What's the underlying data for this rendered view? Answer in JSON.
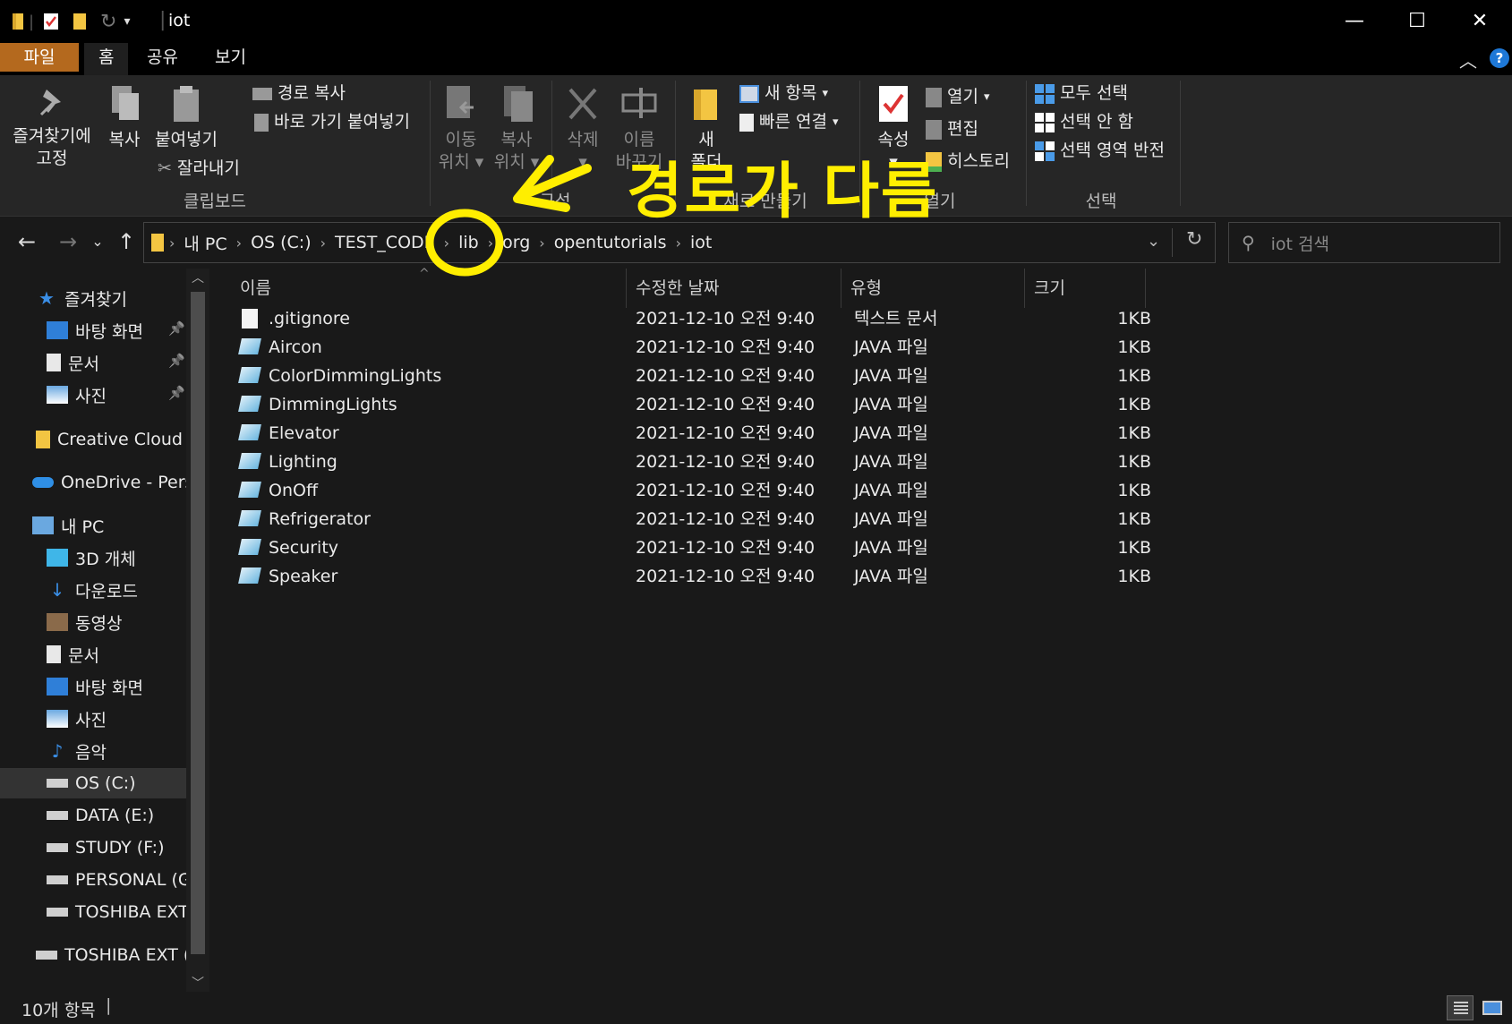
{
  "window": {
    "title": "iot",
    "minimize_glyph": "—",
    "maximize_glyph": "☐",
    "close_glyph": "✕"
  },
  "ribbon_tabs": [
    "파일",
    "홈",
    "공유",
    "보기"
  ],
  "ribbon": {
    "clipboard": {
      "pin_label_1": "즐겨찾기에",
      "pin_label_2": "고정",
      "copy": "복사",
      "paste": "붙여넣기",
      "copy_path": "경로 복사",
      "paste_shortcut": "바로 가기 붙여넣기",
      "cut": "잘라내기",
      "group": "클립보드"
    },
    "organize": {
      "move_to_1": "이동",
      "move_to_2": "위치",
      "copy_to_1": "복사",
      "copy_to_2": "위치",
      "delete": "삭제",
      "rename_1": "이름",
      "rename_2": "바꾸기",
      "group": "구성"
    },
    "new": {
      "new_folder_1": "새",
      "new_folder_2": "폴더",
      "new_item": "새 항목",
      "easy_access": "빠른 연결",
      "group": "새로 만들기"
    },
    "open": {
      "properties": "속성",
      "open": "열기",
      "edit": "편집",
      "history": "히스토리",
      "group": "열기"
    },
    "select": {
      "select_all": "모두 선택",
      "select_none": "선택 안 함",
      "invert": "선택 영역 반전",
      "group": "선택"
    }
  },
  "address": {
    "crumbs": [
      "내 PC",
      "OS (C:)",
      "TEST_CODE",
      "lib",
      "org",
      "opentutorials",
      "iot"
    ],
    "search_placeholder": "iot 검색"
  },
  "nav_pane": {
    "items": [
      {
        "label": "즐겨찾기",
        "icon": "star-icon",
        "pinned": false
      },
      {
        "label": "바탕 화면",
        "icon": "desktop-icon",
        "pinned": true
      },
      {
        "label": "문서",
        "icon": "document-icon",
        "pinned": true
      },
      {
        "label": "사진",
        "icon": "pictures-icon",
        "pinned": true
      },
      {
        "label": "Creative Cloud Files",
        "icon": "creative-cloud-icon",
        "pinned": false
      },
      {
        "label": "OneDrive - Personal",
        "icon": "onedrive-icon",
        "pinned": false
      },
      {
        "label": "내 PC",
        "icon": "pc-icon",
        "pinned": false
      },
      {
        "label": "3D 개체",
        "icon": "3d-objects-icon",
        "pinned": false
      },
      {
        "label": "다운로드",
        "icon": "download-icon",
        "pinned": false
      },
      {
        "label": "동영상",
        "icon": "video-icon",
        "pinned": false
      },
      {
        "label": "문서",
        "icon": "document-icon",
        "pinned": false
      },
      {
        "label": "바탕 화면",
        "icon": "desktop-icon",
        "pinned": false
      },
      {
        "label": "사진",
        "icon": "pictures-icon",
        "pinned": false
      },
      {
        "label": "음악",
        "icon": "music-icon",
        "pinned": false
      },
      {
        "label": "OS (C:)",
        "icon": "drive-icon",
        "pinned": false,
        "selected": true
      },
      {
        "label": "DATA (E:)",
        "icon": "drive-icon",
        "pinned": false
      },
      {
        "label": "STUDY (F:)",
        "icon": "drive-icon",
        "pinned": false
      },
      {
        "label": "PERSONAL (G:)",
        "icon": "drive-icon",
        "pinned": false
      },
      {
        "label": "TOSHIBA EXT (I:)",
        "icon": "drive-icon",
        "pinned": false
      },
      {
        "label": "TOSHIBA EXT (I:)",
        "icon": "drive-icon",
        "pinned": false
      }
    ]
  },
  "file_list": {
    "columns": [
      "이름",
      "수정한 날짜",
      "유형",
      "크기"
    ],
    "rows": [
      {
        "name": ".gitignore",
        "date": "2021-12-10 오전 9:40",
        "type": "텍스트 문서",
        "size": "1KB",
        "icon": "text-file-icon"
      },
      {
        "name": "Aircon",
        "date": "2021-12-10 오전 9:40",
        "type": "JAVA 파일",
        "size": "1KB",
        "icon": "java-file-icon"
      },
      {
        "name": "ColorDimmingLights",
        "date": "2021-12-10 오전 9:40",
        "type": "JAVA 파일",
        "size": "1KB",
        "icon": "java-file-icon"
      },
      {
        "name": "DimmingLights",
        "date": "2021-12-10 오전 9:40",
        "type": "JAVA 파일",
        "size": "1KB",
        "icon": "java-file-icon"
      },
      {
        "name": "Elevator",
        "date": "2021-12-10 오전 9:40",
        "type": "JAVA 파일",
        "size": "1KB",
        "icon": "java-file-icon"
      },
      {
        "name": "Lighting",
        "date": "2021-12-10 오전 9:40",
        "type": "JAVA 파일",
        "size": "1KB",
        "icon": "java-file-icon"
      },
      {
        "name": "OnOff",
        "date": "2021-12-10 오전 9:40",
        "type": "JAVA 파일",
        "size": "1KB",
        "icon": "java-file-icon"
      },
      {
        "name": "Refrigerator",
        "date": "2021-12-10 오전 9:40",
        "type": "JAVA 파일",
        "size": "1KB",
        "icon": "java-file-icon"
      },
      {
        "name": "Security",
        "date": "2021-12-10 오전 9:40",
        "type": "JAVA 파일",
        "size": "1KB",
        "icon": "java-file-icon"
      },
      {
        "name": "Speaker",
        "date": "2021-12-10 오전 9:40",
        "type": "JAVA 파일",
        "size": "1KB",
        "icon": "java-file-icon"
      }
    ]
  },
  "status": {
    "item_count": "10개 항목"
  },
  "annotation": {
    "text": "경로가 다름",
    "color": "#ffee00"
  },
  "colors": {
    "file_tab": "#b4691e",
    "background": "#191919",
    "ribbon": "#262626"
  }
}
